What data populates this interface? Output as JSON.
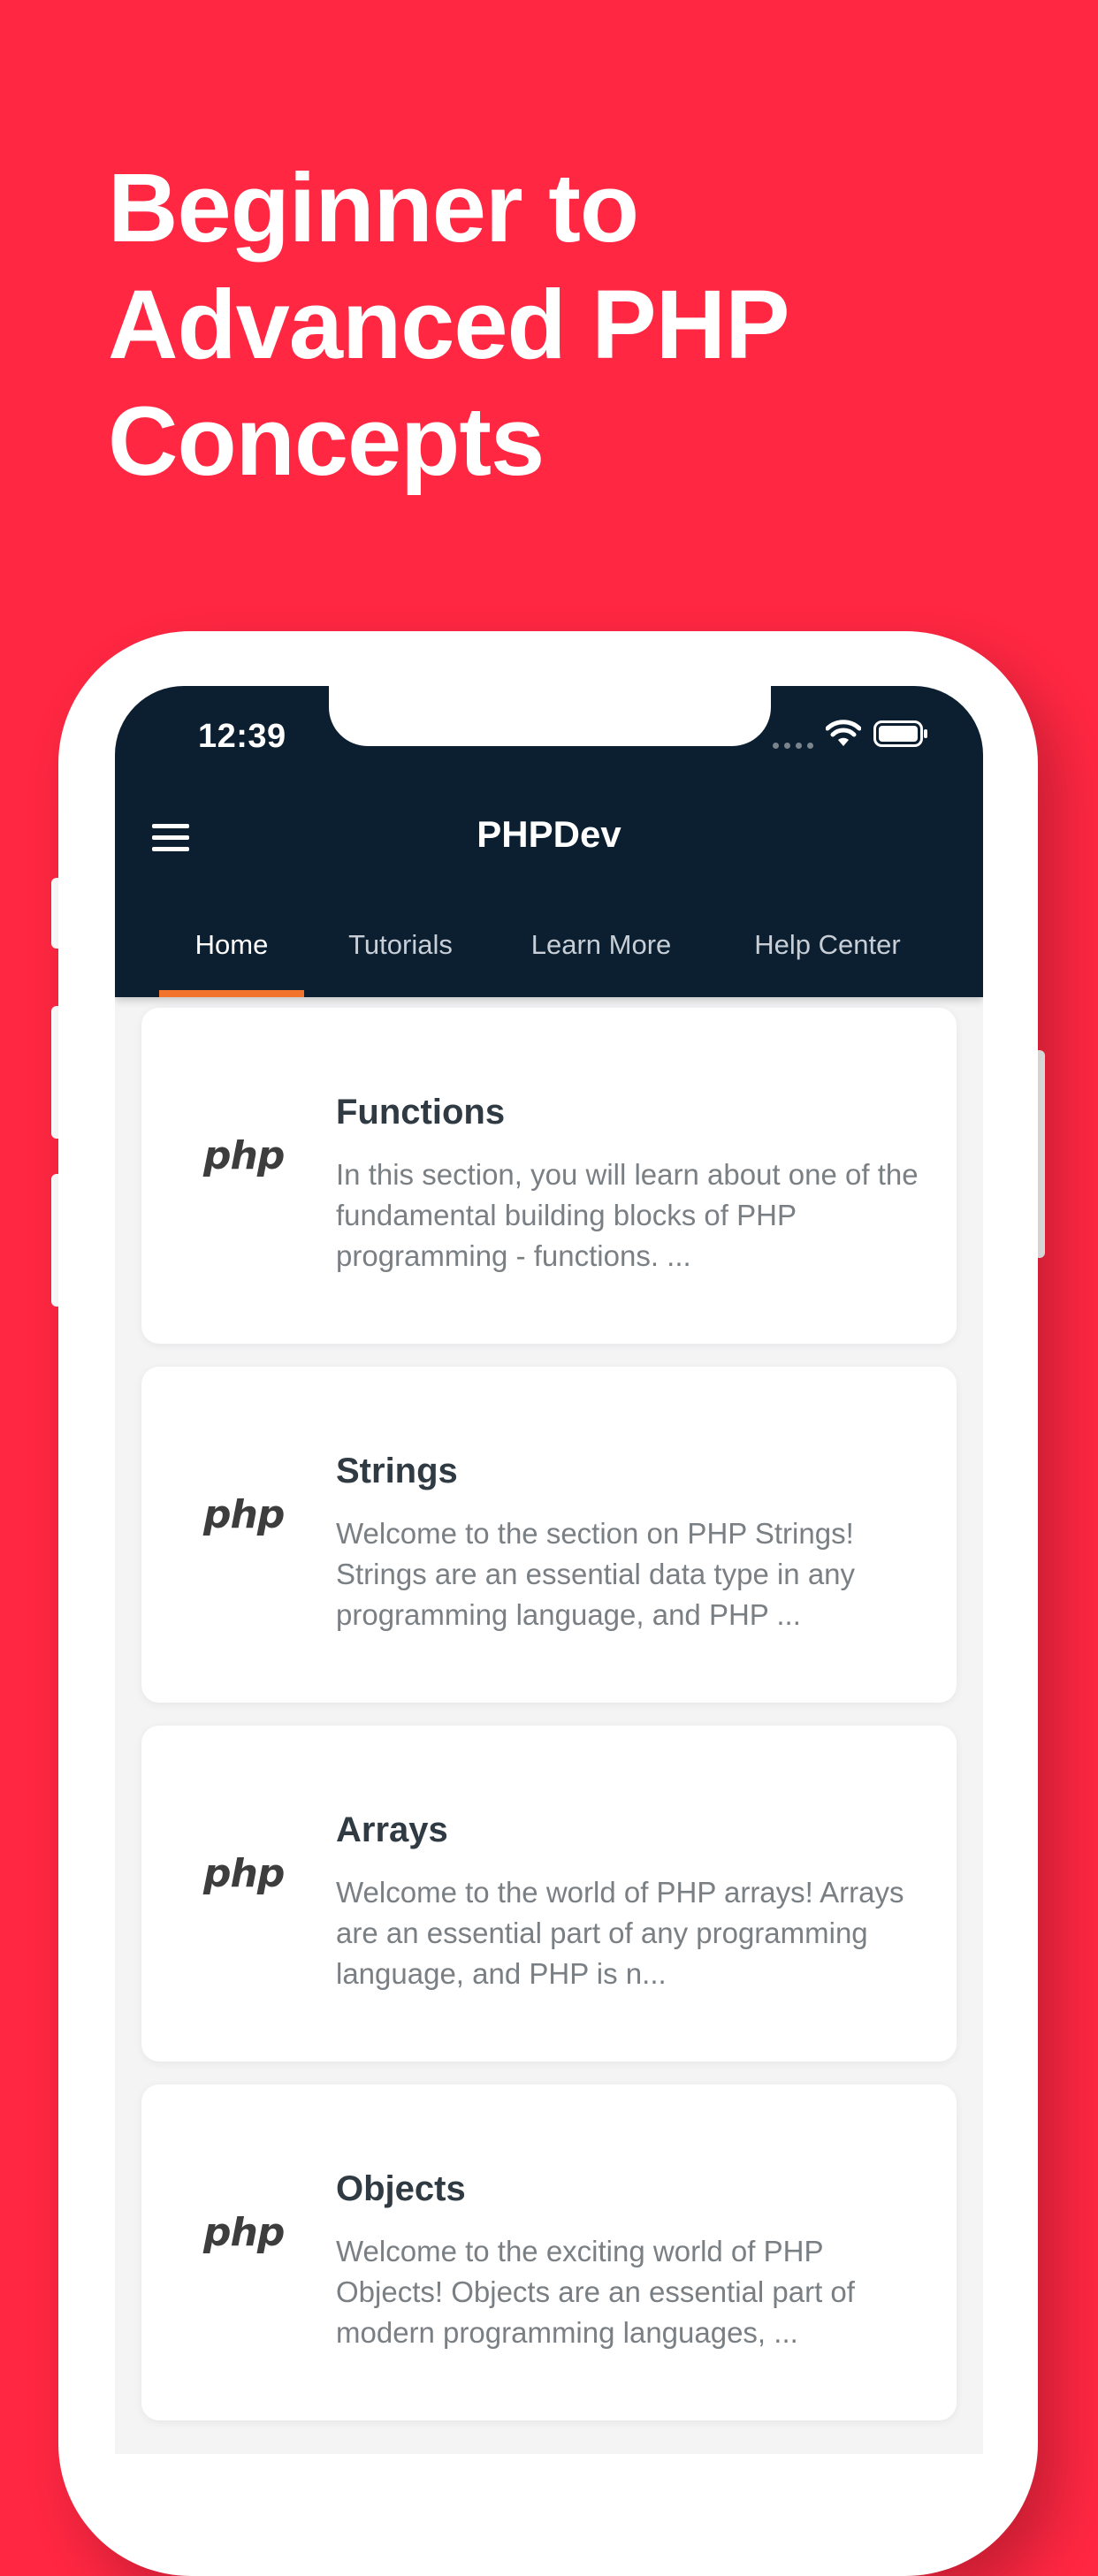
{
  "headline": {
    "line1": "Beginner to",
    "line2": "Advanced PHP",
    "line3": "Concepts"
  },
  "status_bar": {
    "time": "12:39",
    "icons": [
      "cellular-signal-icon",
      "wifi-icon",
      "battery-icon"
    ]
  },
  "app_bar": {
    "menu_icon": "hamburger-menu-icon",
    "title": "PHPDev"
  },
  "tabs": [
    {
      "label": "Home",
      "active": true
    },
    {
      "label": "Tutorials",
      "active": false
    },
    {
      "label": "Learn More",
      "active": false
    },
    {
      "label": "Help Center",
      "active": false
    }
  ],
  "cards": [
    {
      "logo": "php",
      "title": "Functions",
      "description": "In this section, you will learn about one of the fundamental building blocks of PHP programming - functions. ..."
    },
    {
      "logo": "php",
      "title": "Strings",
      "description": "Welcome to the section on PHP Strings! Strings are an essential data type in any programming language, and PHP ..."
    },
    {
      "logo": "php",
      "title": "Arrays",
      "description": "Welcome to the world of PHP arrays! Arrays are an essential part of any programming language, and PHP is n..."
    },
    {
      "logo": "php",
      "title": "Objects",
      "description": "Welcome to the exciting world of PHP Objects! Objects are an essential part of modern programming languages, ..."
    }
  ],
  "colors": {
    "background": "#ff2742",
    "app_bar": "#0c1f31",
    "tab_indicator": "#f2732b"
  }
}
